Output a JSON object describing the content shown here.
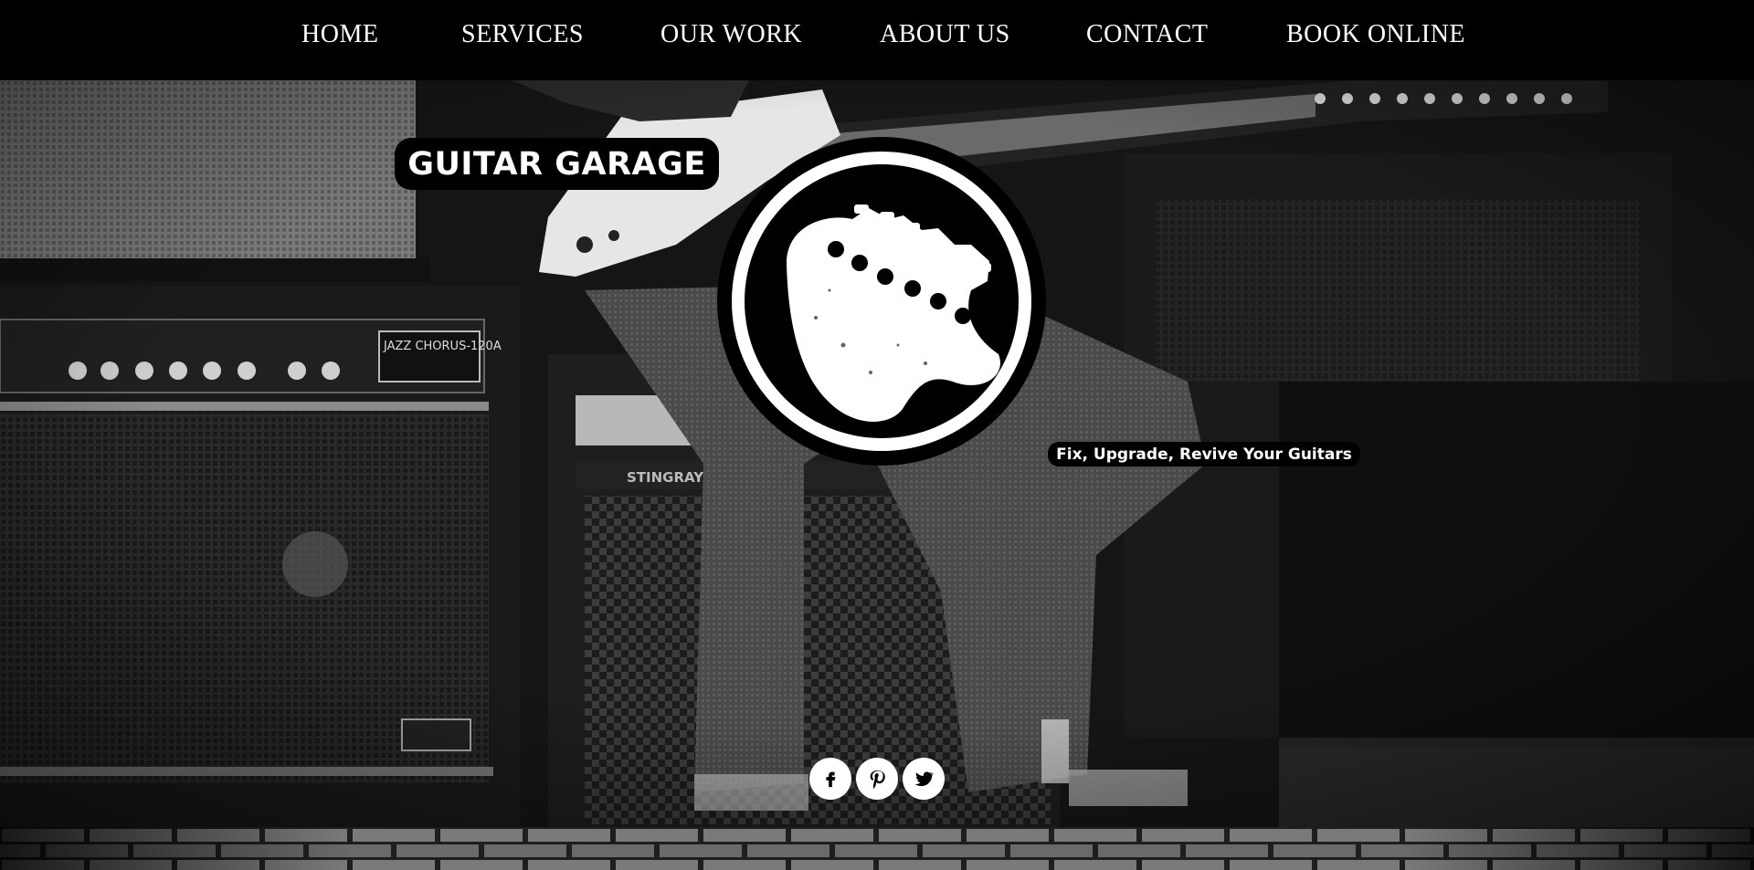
{
  "nav": {
    "items": [
      {
        "label": "HOME"
      },
      {
        "label": "SERVICES"
      },
      {
        "label": "OUR WORK"
      },
      {
        "label": "ABOUT US"
      },
      {
        "label": "CONTACT"
      },
      {
        "label": "BOOK ONLINE"
      }
    ]
  },
  "hero": {
    "title": "GUITAR GARAGE",
    "tagline": "Fix, Upgrade, Revive Your Guitars",
    "logo_icon": "guitar-headstock-logo"
  },
  "social": {
    "icons": [
      "facebook-icon",
      "pinterest-icon",
      "twitter-icon"
    ]
  },
  "colors": {
    "nav_bg": "#000000",
    "text": "#ffffff",
    "hero_bg": "#141414"
  }
}
